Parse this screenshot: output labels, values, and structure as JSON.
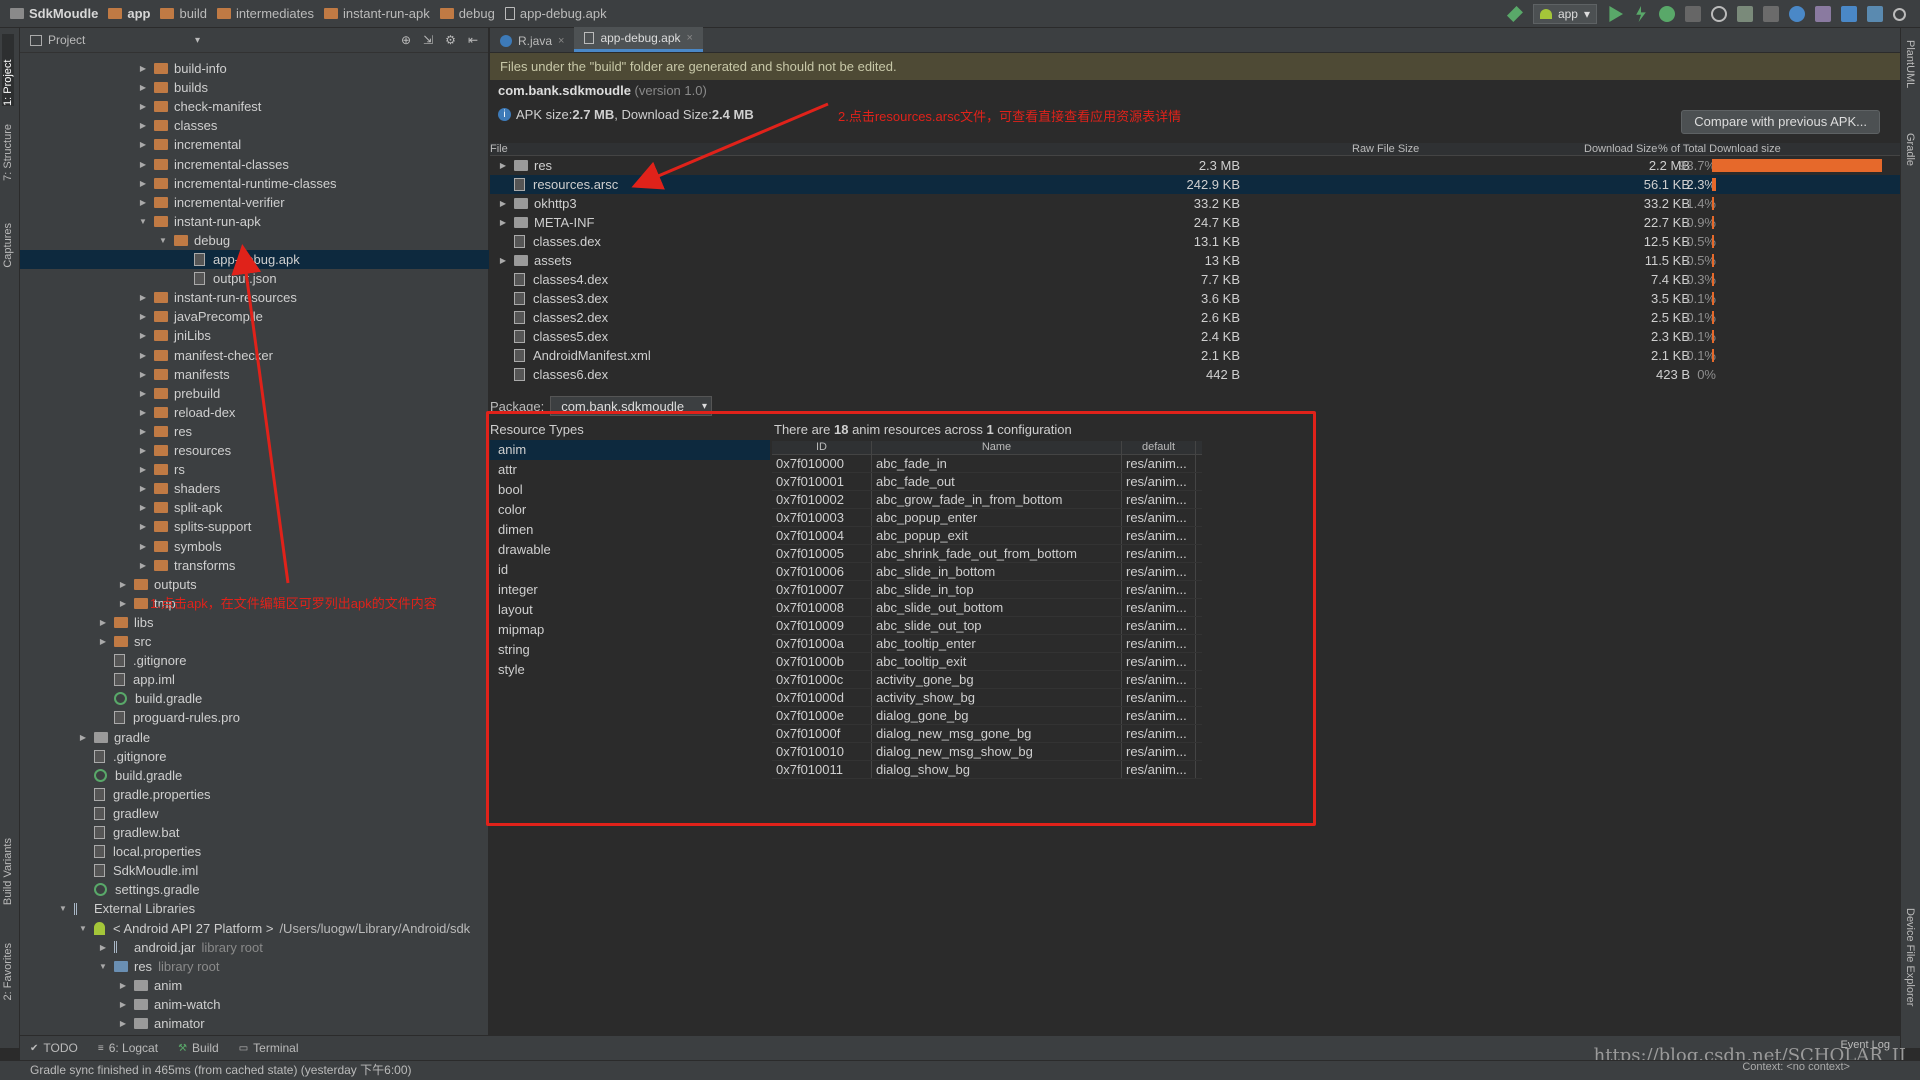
{
  "breadcrumb": [
    {
      "label": "SdkMoudle",
      "bold": true
    },
    {
      "label": "app",
      "bold": true
    },
    {
      "label": "build",
      "bold": false
    },
    {
      "label": "intermediates",
      "bold": false
    },
    {
      "label": "instant-run-apk",
      "bold": false
    },
    {
      "label": "debug",
      "bold": false
    },
    {
      "label": "app-debug.apk",
      "bold": false
    }
  ],
  "toolbar": {
    "run_config": "app"
  },
  "left_strip": {
    "project": "1: Project",
    "structure": "7: Structure",
    "captures": "Captures",
    "build_variants": "Build Variants",
    "favorites": "2: Favorites"
  },
  "right_strip": {
    "plantuml": "PlantUML",
    "gradle": "Gradle",
    "device_explorer": "Device File Explorer"
  },
  "project_panel": {
    "title": "Project",
    "tree": [
      {
        "label": "build-info",
        "depth": 4,
        "type": "folder",
        "arrow": "right"
      },
      {
        "label": "builds",
        "depth": 4,
        "type": "folder",
        "arrow": "right"
      },
      {
        "label": "check-manifest",
        "depth": 4,
        "type": "folder",
        "arrow": "right"
      },
      {
        "label": "classes",
        "depth": 4,
        "type": "folder",
        "arrow": "right"
      },
      {
        "label": "incremental",
        "depth": 4,
        "type": "folder",
        "arrow": "right"
      },
      {
        "label": "incremental-classes",
        "depth": 4,
        "type": "folder",
        "arrow": "right"
      },
      {
        "label": "incremental-runtime-classes",
        "depth": 4,
        "type": "folder",
        "arrow": "right"
      },
      {
        "label": "incremental-verifier",
        "depth": 4,
        "type": "folder",
        "arrow": "right"
      },
      {
        "label": "instant-run-apk",
        "depth": 4,
        "type": "folder",
        "arrow": "down"
      },
      {
        "label": "debug",
        "depth": 5,
        "type": "folder",
        "arrow": "down"
      },
      {
        "label": "app-debug.apk",
        "depth": 6,
        "type": "file",
        "arrow": "",
        "selected": true
      },
      {
        "label": "output.json",
        "depth": 6,
        "type": "file",
        "arrow": ""
      },
      {
        "label": "instant-run-resources",
        "depth": 4,
        "type": "folder",
        "arrow": "right"
      },
      {
        "label": "javaPrecompile",
        "depth": 4,
        "type": "folder",
        "arrow": "right"
      },
      {
        "label": "jniLibs",
        "depth": 4,
        "type": "folder",
        "arrow": "right"
      },
      {
        "label": "manifest-checker",
        "depth": 4,
        "type": "folder",
        "arrow": "right"
      },
      {
        "label": "manifests",
        "depth": 4,
        "type": "folder",
        "arrow": "right"
      },
      {
        "label": "prebuild",
        "depth": 4,
        "type": "folder",
        "arrow": "right"
      },
      {
        "label": "reload-dex",
        "depth": 4,
        "type": "folder",
        "arrow": "right"
      },
      {
        "label": "res",
        "depth": 4,
        "type": "folder",
        "arrow": "right"
      },
      {
        "label": "resources",
        "depth": 4,
        "type": "folder",
        "arrow": "right"
      },
      {
        "label": "rs",
        "depth": 4,
        "type": "folder",
        "arrow": "right"
      },
      {
        "label": "shaders",
        "depth": 4,
        "type": "folder",
        "arrow": "right"
      },
      {
        "label": "split-apk",
        "depth": 4,
        "type": "folder",
        "arrow": "right"
      },
      {
        "label": "splits-support",
        "depth": 4,
        "type": "folder",
        "arrow": "right"
      },
      {
        "label": "symbols",
        "depth": 4,
        "type": "folder",
        "arrow": "right"
      },
      {
        "label": "transforms",
        "depth": 4,
        "type": "folder",
        "arrow": "right"
      },
      {
        "label": "outputs",
        "depth": 3,
        "type": "folder",
        "arrow": "right"
      },
      {
        "label": "tmp",
        "depth": 3,
        "type": "folder",
        "arrow": "right"
      },
      {
        "label": "libs",
        "depth": 2,
        "type": "folder",
        "arrow": "right"
      },
      {
        "label": "src",
        "depth": 2,
        "type": "folder",
        "arrow": "right"
      },
      {
        "label": ".gitignore",
        "depth": 2,
        "type": "file",
        "arrow": ""
      },
      {
        "label": "app.iml",
        "depth": 2,
        "type": "file",
        "arrow": ""
      },
      {
        "label": "build.gradle",
        "depth": 2,
        "type": "gradle",
        "arrow": ""
      },
      {
        "label": "proguard-rules.pro",
        "depth": 2,
        "type": "file",
        "arrow": ""
      },
      {
        "label": "gradle",
        "depth": 1,
        "type": "folder-grey",
        "arrow": "right"
      },
      {
        "label": ".gitignore",
        "depth": 1,
        "type": "file",
        "arrow": ""
      },
      {
        "label": "build.gradle",
        "depth": 1,
        "type": "gradle",
        "arrow": ""
      },
      {
        "label": "gradle.properties",
        "depth": 1,
        "type": "file",
        "arrow": ""
      },
      {
        "label": "gradlew",
        "depth": 1,
        "type": "file",
        "arrow": ""
      },
      {
        "label": "gradlew.bat",
        "depth": 1,
        "type": "file",
        "arrow": ""
      },
      {
        "label": "local.properties",
        "depth": 1,
        "type": "file",
        "arrow": ""
      },
      {
        "label": "SdkMoudle.iml",
        "depth": 1,
        "type": "file",
        "arrow": ""
      },
      {
        "label": "settings.gradle",
        "depth": 1,
        "type": "gradle",
        "arrow": ""
      },
      {
        "label": "External Libraries",
        "depth": 0,
        "type": "lib",
        "arrow": "down"
      },
      {
        "label": "< Android API 27 Platform >",
        "depth": 1,
        "type": "android",
        "arrow": "down",
        "suffix": "/Users/luogw/Library/Android/sdk"
      },
      {
        "label": "android.jar",
        "depth": 2,
        "type": "lib",
        "arrow": "right",
        "suffix": "library root"
      },
      {
        "label": "res",
        "depth": 2,
        "type": "folder-blue",
        "arrow": "down",
        "suffix": "library root"
      },
      {
        "label": "anim",
        "depth": 3,
        "type": "folder-grey",
        "arrow": "right"
      },
      {
        "label": "anim-watch",
        "depth": 3,
        "type": "folder-grey",
        "arrow": "right"
      },
      {
        "label": "animator",
        "depth": 3,
        "type": "folder-grey",
        "arrow": "right"
      },
      {
        "label": "color",
        "depth": 3,
        "type": "folder-grey",
        "arrow": "right"
      }
    ]
  },
  "editor": {
    "tabs": [
      {
        "label": "R.java",
        "active": false
      },
      {
        "label": "app-debug.apk",
        "active": true
      }
    ],
    "warning": "Files under the \"build\" folder are generated and should not be edited.",
    "package_name": "com.bank.sdkmoudle",
    "version": "(version 1.0)",
    "apk_size_label": "APK size: ",
    "apk_size": "2.7 MB",
    "download_size_label": ", Download Size: ",
    "download_size": "2.4 MB",
    "compare_button": "Compare with previous APK...",
    "file_table": {
      "headers": {
        "file": "File",
        "raw": "Raw File Size",
        "download": "Download Size",
        "percent": "% of Total Download size"
      },
      "rows": [
        {
          "name": "res",
          "raw": "2.3 MB",
          "download": "2.2 MB",
          "percent": "93.7%",
          "pct": 93.7,
          "type": "folder",
          "arrow": true
        },
        {
          "name": "resources.arsc",
          "raw": "242.9 KB",
          "download": "56.1 KB",
          "percent": "2.3%",
          "pct": 2.3,
          "type": "file",
          "selected": true
        },
        {
          "name": "okhttp3",
          "raw": "33.2 KB",
          "download": "33.2 KB",
          "percent": "1.4%",
          "pct": 1.4,
          "type": "folder",
          "arrow": true
        },
        {
          "name": "META-INF",
          "raw": "24.7 KB",
          "download": "22.7 KB",
          "percent": "0.9%",
          "pct": 0.9,
          "type": "folder",
          "arrow": true
        },
        {
          "name": "classes.dex",
          "raw": "13.1 KB",
          "download": "12.5 KB",
          "percent": "0.5%",
          "pct": 0.5,
          "type": "file"
        },
        {
          "name": "assets",
          "raw": "13 KB",
          "download": "11.5 KB",
          "percent": "0.5%",
          "pct": 0.5,
          "type": "folder",
          "arrow": true
        },
        {
          "name": "classes4.dex",
          "raw": "7.7 KB",
          "download": "7.4 KB",
          "percent": "0.3%",
          "pct": 0.3,
          "type": "file"
        },
        {
          "name": "classes3.dex",
          "raw": "3.6 KB",
          "download": "3.5 KB",
          "percent": "0.1%",
          "pct": 0.1,
          "type": "file"
        },
        {
          "name": "classes2.dex",
          "raw": "2.6 KB",
          "download": "2.5 KB",
          "percent": "0.1%",
          "pct": 0.1,
          "type": "file"
        },
        {
          "name": "classes5.dex",
          "raw": "2.4 KB",
          "download": "2.3 KB",
          "percent": "0.1%",
          "pct": 0.1,
          "type": "file"
        },
        {
          "name": "AndroidManifest.xml",
          "raw": "2.1 KB",
          "download": "2.1 KB",
          "percent": "0.1%",
          "pct": 0.1,
          "type": "file"
        },
        {
          "name": "classes6.dex",
          "raw": "442 B",
          "download": "423 B",
          "percent": "0%",
          "pct": 0,
          "type": "file"
        }
      ]
    },
    "package_label": "Package:",
    "package_select": "com.bank.sdkmoudle",
    "resource_types_title": "Resource Types",
    "resource_types": [
      "anim",
      "attr",
      "bool",
      "color",
      "dimen",
      "drawable",
      "id",
      "integer",
      "layout",
      "mipmap",
      "string",
      "style"
    ],
    "resource_summary": {
      "prefix": "There are ",
      "count": "18",
      "middle": " anim resources across ",
      "configs": "1",
      "suffix": " configuration"
    },
    "resource_table": {
      "headers": {
        "id": "ID",
        "name": "Name",
        "default": "default"
      },
      "rows": [
        {
          "id": "0x7f010000",
          "name": "abc_fade_in",
          "default": "res/anim..."
        },
        {
          "id": "0x7f010001",
          "name": "abc_fade_out",
          "default": "res/anim..."
        },
        {
          "id": "0x7f010002",
          "name": "abc_grow_fade_in_from_bottom",
          "default": "res/anim..."
        },
        {
          "id": "0x7f010003",
          "name": "abc_popup_enter",
          "default": "res/anim..."
        },
        {
          "id": "0x7f010004",
          "name": "abc_popup_exit",
          "default": "res/anim..."
        },
        {
          "id": "0x7f010005",
          "name": "abc_shrink_fade_out_from_bottom",
          "default": "res/anim..."
        },
        {
          "id": "0x7f010006",
          "name": "abc_slide_in_bottom",
          "default": "res/anim..."
        },
        {
          "id": "0x7f010007",
          "name": "abc_slide_in_top",
          "default": "res/anim..."
        },
        {
          "id": "0x7f010008",
          "name": "abc_slide_out_bottom",
          "default": "res/anim..."
        },
        {
          "id": "0x7f010009",
          "name": "abc_slide_out_top",
          "default": "res/anim..."
        },
        {
          "id": "0x7f01000a",
          "name": "abc_tooltip_enter",
          "default": "res/anim..."
        },
        {
          "id": "0x7f01000b",
          "name": "abc_tooltip_exit",
          "default": "res/anim..."
        },
        {
          "id": "0x7f01000c",
          "name": "activity_gone_bg",
          "default": "res/anim..."
        },
        {
          "id": "0x7f01000d",
          "name": "activity_show_bg",
          "default": "res/anim..."
        },
        {
          "id": "0x7f01000e",
          "name": "dialog_gone_bg",
          "default": "res/anim..."
        },
        {
          "id": "0x7f01000f",
          "name": "dialog_new_msg_gone_bg",
          "default": "res/anim..."
        },
        {
          "id": "0x7f010010",
          "name": "dialog_new_msg_show_bg",
          "default": "res/anim..."
        },
        {
          "id": "0x7f010011",
          "name": "dialog_show_bg",
          "default": "res/anim..."
        }
      ]
    }
  },
  "annotations": {
    "note1": "1.点击apk，在文件编辑区可罗列出apk的文件内容",
    "note2": "2.点击resources.arsc文件，可查看直接查看应用资源表详情"
  },
  "bottom_tabs": [
    "TODO",
    "6: Logcat",
    "Build",
    "Terminal"
  ],
  "event_log": "Event Log",
  "status_text": "Gradle sync finished in 465ms (from cached state) (yesterday 下午6:00)",
  "context_text": "Context: <no context>",
  "watermark": "https://blog.csdn.net/SCHOLAR_II",
  "colors": {
    "accent": "#4a88c7",
    "selection": "#0d293e",
    "annotation": "#e0221a",
    "bar": "#e6692b"
  }
}
